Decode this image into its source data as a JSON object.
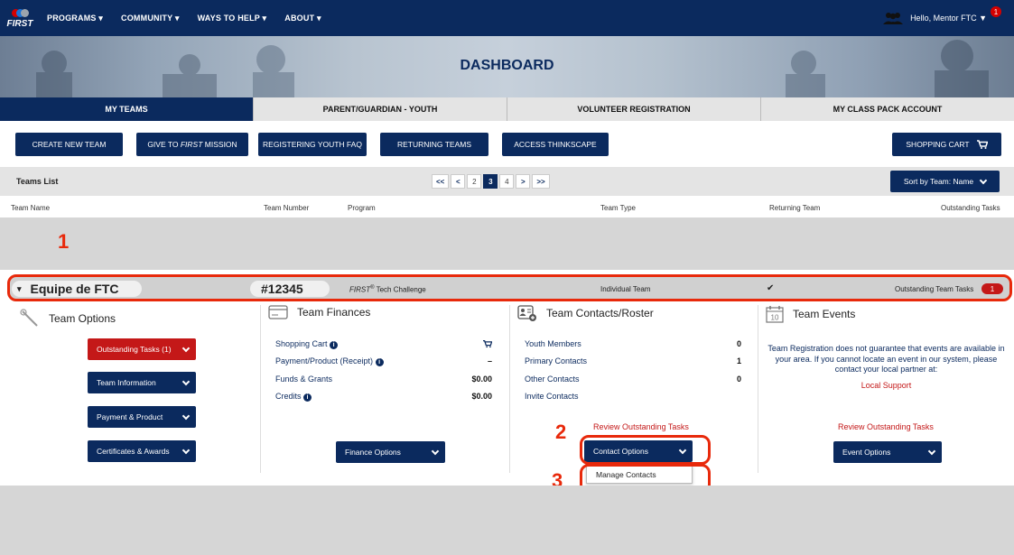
{
  "nav": {
    "logo_text": "FIRST",
    "items": [
      "PROGRAMS ▾",
      "COMMUNITY ▾",
      "WAYS TO HELP ▾",
      "ABOUT ▾"
    ],
    "greeting": "Hello, Mentor FTC ▼",
    "notification_count": "1"
  },
  "hero": {
    "title": "DASHBOARD"
  },
  "tabs": [
    "MY TEAMS",
    "PARENT/GUARDIAN - YOUTH",
    "VOLUNTEER REGISTRATION",
    "MY CLASS PACK ACCOUNT"
  ],
  "actions": {
    "create_team": "CREATE NEW TEAM",
    "give_mission_prefix": "GIVE TO ",
    "give_mission_italic": "FIRST",
    "give_mission_suffix": " MISSION",
    "youth_faq": "REGISTERING YOUTH FAQ",
    "returning": "RETURNING TEAMS",
    "thinkscape": "ACCESS THINKSCAPE",
    "cart": "SHOPPING CART"
  },
  "toolbar": {
    "label": "Teams List",
    "pager": {
      "first": "<<",
      "prev": "<",
      "pages": [
        "2",
        "3",
        "4"
      ],
      "current": "3",
      "next": ">",
      "last": ">>"
    },
    "sort": "Sort by Team: Name"
  },
  "columns": [
    "Team Name",
    "Team Number",
    "Program",
    "Team Type",
    "Returning Team",
    "Outstanding Tasks"
  ],
  "annotations": {
    "a1": "1",
    "a2": "2",
    "a3": "3"
  },
  "team": {
    "name": "Equipe de FTC",
    "number": "#12345",
    "program_italic": "FIRST",
    "program_sup": "®",
    "program_rest": " Tech Challenge",
    "type": "Individual Team",
    "returning": "✔",
    "tasks_label": "Outstanding Team Tasks",
    "tasks_count": "1"
  },
  "options": {
    "title": "Team Options",
    "outstanding": "Outstanding Tasks (1)",
    "info": "Team Information",
    "payment": "Payment & Product",
    "certs": "Certificates & Awards"
  },
  "finances": {
    "title": "Team Finances",
    "rows": [
      {
        "label": "Shopping Cart",
        "value": ""
      },
      {
        "label": "Payment/Product (Receipt)",
        "value": "–"
      },
      {
        "label": "Funds & Grants",
        "value": "$0.00"
      },
      {
        "label": "Credits",
        "value": "$0.00"
      }
    ],
    "button": "Finance Options"
  },
  "contacts": {
    "title": "Team Contacts/Roster",
    "rows": [
      {
        "label": "Youth Members",
        "value": "0"
      },
      {
        "label": "Primary Contacts",
        "value": "1"
      },
      {
        "label": "Other Contacts",
        "value": "0"
      },
      {
        "label": "Invite Contacts",
        "value": ""
      }
    ],
    "review": "Review Outstanding Tasks",
    "button": "Contact Options",
    "menu_item": "Manage Contacts"
  },
  "events": {
    "title": "Team Events",
    "notice": "Team Registration does not guarantee that events are available in your area. If you cannot locate an event in our system, please contact your local partner at:",
    "local_support": "Local Support",
    "review": "Review Outstanding Tasks",
    "button": "Event Options",
    "calendar_day": "10"
  },
  "colors": {
    "navy": "#0b2a5e",
    "red": "#c41818",
    "annotation": "#e8290b"
  }
}
